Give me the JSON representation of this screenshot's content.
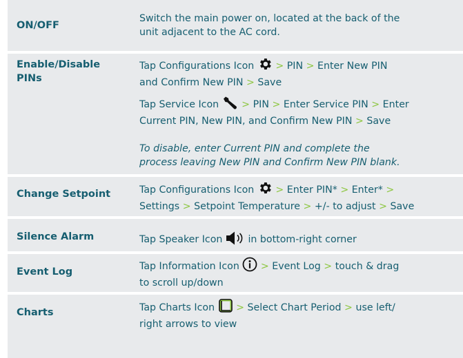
{
  "colors": {
    "label_text": "#165e70",
    "arrow": "#8cc63f",
    "row_bg": "#e8eaec",
    "separator": "#ffffff"
  },
  "rows": [
    {
      "label": "ON/OFF",
      "lines": [
        "Switch the main power on, located at the back of the",
        "unit adjacent to the AC cord."
      ]
    },
    {
      "label_lines": [
        "Enable/Disable",
        "PINs"
      ],
      "p1": {
        "t1": "Tap Configurations Icon",
        "icon": "gear-icon",
        "s1": ">",
        "t2": "PIN",
        "s2": ">",
        "t3": "Enter New PIN",
        "t4": "and Confirm New PIN",
        "s3": ">",
        "t5": "Save"
      },
      "p2": {
        "t1": "Tap Service Icon",
        "icon": "wrench-icon",
        "s1": ">",
        "t2": "PIN",
        "s2": ">",
        "t3": "Enter Service PIN",
        "s3": ">",
        "t4": "Enter",
        "t5": "Current PIN, New PIN, and Confirm New PIN",
        "s4": ">",
        "t6": "Save"
      },
      "note_lines": [
        "To disable, enter Current PIN and complete the",
        "process leaving New PIN and Confirm New PIN blank."
      ]
    },
    {
      "label": "Change Setpoint",
      "p1": {
        "t1": "Tap Configurations Icon",
        "icon": "gear-icon",
        "s1": ">",
        "t2": "Enter PIN*",
        "s2": ">",
        "t3": "Enter*",
        "s3": ">",
        "t4": "Settings",
        "s4": ">",
        "t5": "Setpoint Temperature",
        "s5": ">",
        "t6": "+/- to adjust",
        "s6": ">",
        "t7": "Save"
      }
    },
    {
      "label": "Silence Alarm",
      "p1": {
        "t1": "Tap Speaker Icon",
        "icon": "speaker-icon",
        "t2": "in bottom-right corner"
      }
    },
    {
      "label": "Event Log",
      "p1": {
        "t1": "Tap Information Icon",
        "icon": "info-icon",
        "s1": ">",
        "t2": "Event Log",
        "s2": ">",
        "t3": "touch & drag",
        "t4": "to scroll up/down"
      }
    },
    {
      "label": "Charts",
      "p1": {
        "t1": "Tap Charts Icon",
        "icon": "chart-icon",
        "s1": ">",
        "t2": "Select Chart Period",
        "s2": ">",
        "t3": "use left/",
        "t4": "right arrows to view"
      }
    }
  ]
}
